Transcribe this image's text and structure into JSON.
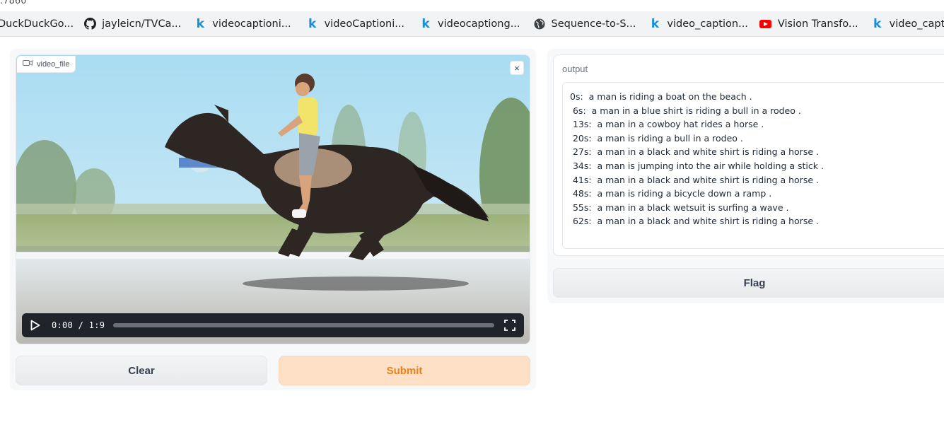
{
  "browser": {
    "url_fragment": ":7860",
    "bookmarks": [
      {
        "label": "DuckDuckGo...",
        "icon": "none"
      },
      {
        "label": "jayleicn/TVCa...",
        "icon": "github-icon"
      },
      {
        "label": "videocaptioni...",
        "icon": "kaggle-icon"
      },
      {
        "label": "videoCaptioni...",
        "icon": "kaggle-icon"
      },
      {
        "label": "videocaptiong...",
        "icon": "kaggle-icon"
      },
      {
        "label": "Sequence-to-S...",
        "icon": "globe-icon"
      },
      {
        "label": "video_caption...",
        "icon": "kaggle-icon"
      },
      {
        "label": "Vision Transfo...",
        "icon": "youtube-icon"
      },
      {
        "label": "video_caption...",
        "icon": "kaggle-icon"
      }
    ]
  },
  "input": {
    "label": "video_file",
    "close_symbol": "×",
    "time_display": "0:00 / 1:9",
    "progress": 0
  },
  "buttons": {
    "clear": "Clear",
    "submit": "Submit",
    "flag": "Flag"
  },
  "output": {
    "label": "output",
    "lines": [
      "0s:  a man is riding a boat on the beach .",
      " 6s:  a man in a blue shirt is riding a bull in a rodeo .",
      " 13s:  a man in a cowboy hat rides a horse .",
      " 20s:  a man is riding a bull in a rodeo .",
      " 27s:  a man in a black and white shirt is riding a horse .",
      " 34s:  a man is jumping into the air while holding a stick .",
      " 41s:  a man in a black and white shirt is riding a horse .",
      " 48s:  a man is riding a bicycle down a ramp .",
      " 55s:  a man in a black wetsuit is surfing a wave .",
      " 62s:  a man in a black and white shirt is riding a horse ."
    ]
  },
  "colors": {
    "submit_bg": "#fde0c6",
    "submit_text": "#f07f19",
    "panel_bg": "#f7f8f9"
  }
}
